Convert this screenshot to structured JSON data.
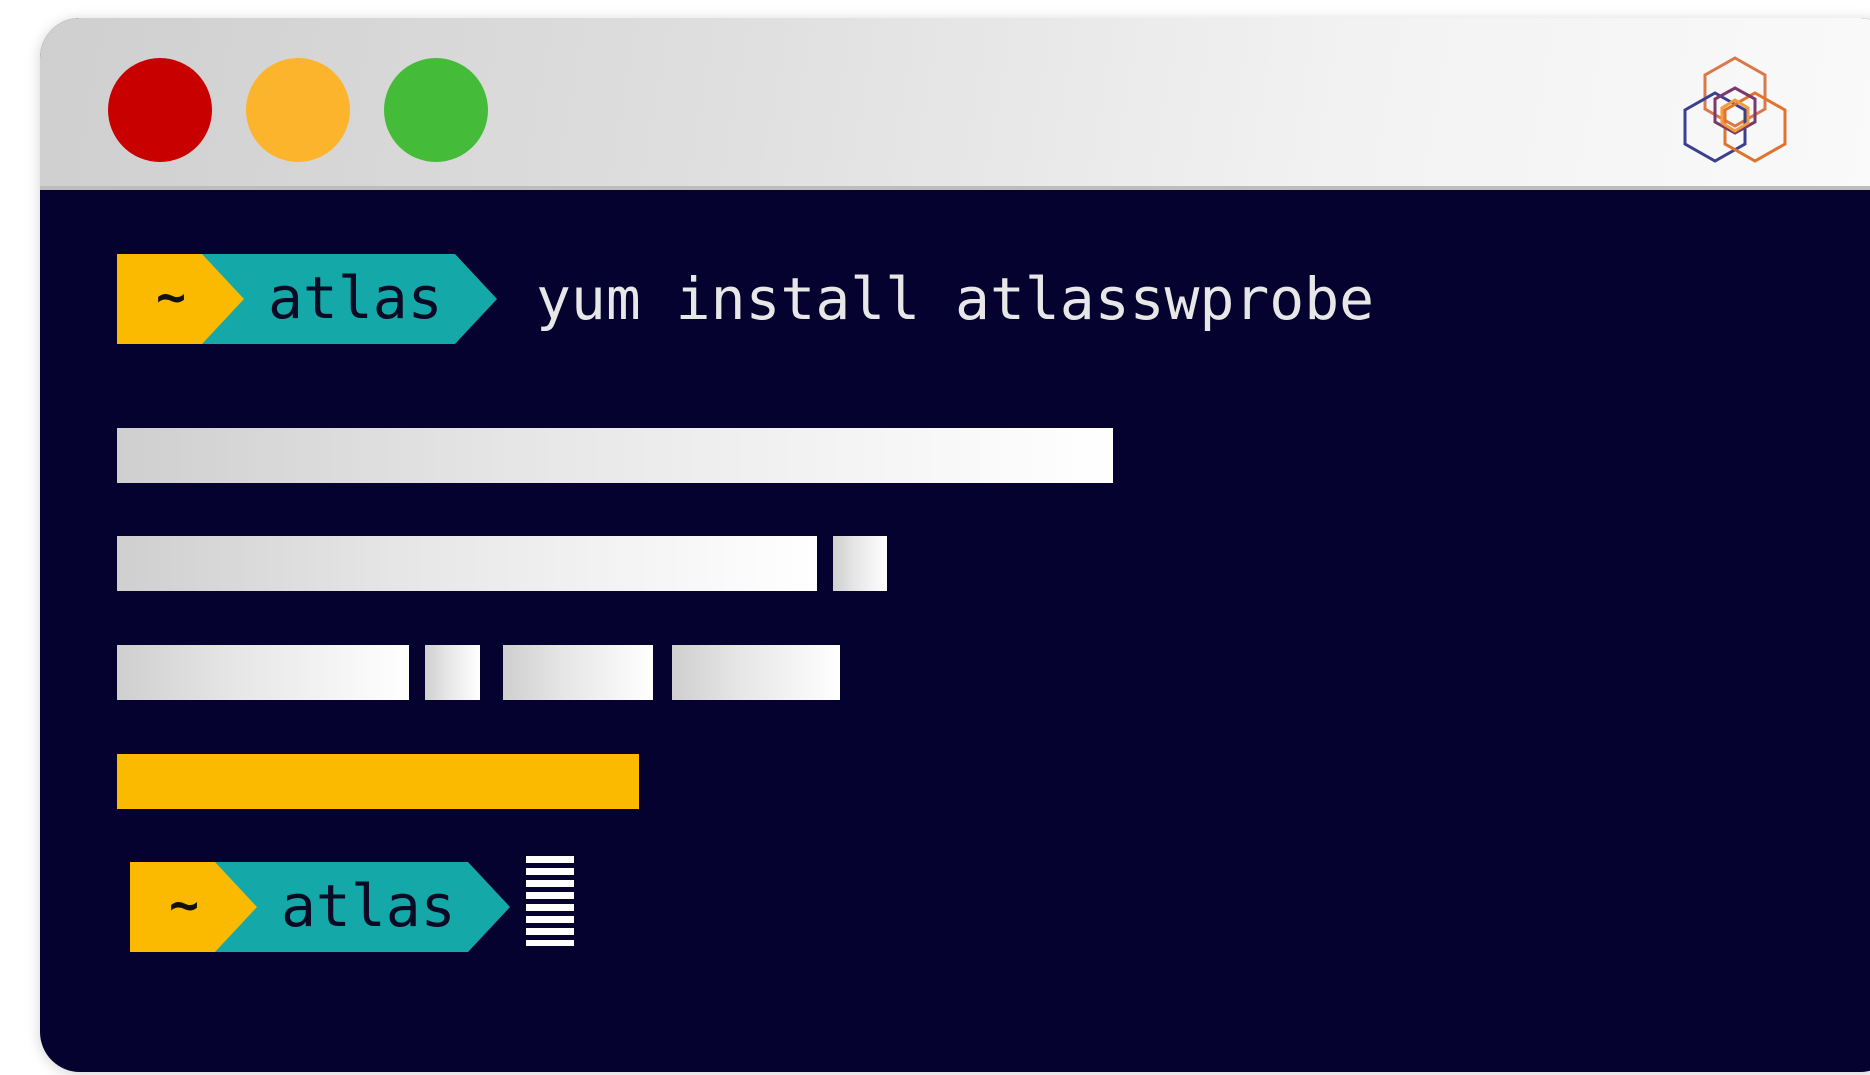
{
  "window": {
    "controls": [
      {
        "name": "close-button",
        "color": "#c80000"
      },
      {
        "name": "minimize-button",
        "color": "#fcb42c"
      },
      {
        "name": "maximize-button",
        "color": "#45bb3a"
      }
    ],
    "logo": "ripe-atlas-hexagon-logo"
  },
  "terminal": {
    "prompt1": {
      "path": "~",
      "user": "atlas"
    },
    "command": "yum install atlasswprobe",
    "output_bars": [
      {
        "line": 1,
        "segments": 1
      },
      {
        "line": 2,
        "segments": 2
      },
      {
        "line": 3,
        "segments": 4
      },
      {
        "line": 4,
        "segments": 1,
        "color": "#fbb900"
      }
    ],
    "prompt2": {
      "path": "~",
      "user": "atlas"
    },
    "cursor": "block-cursor"
  },
  "colors": {
    "background": "#060230",
    "prompt_path": "#fbb900",
    "prompt_user": "#14a9a8",
    "accent": "#fbb900"
  }
}
